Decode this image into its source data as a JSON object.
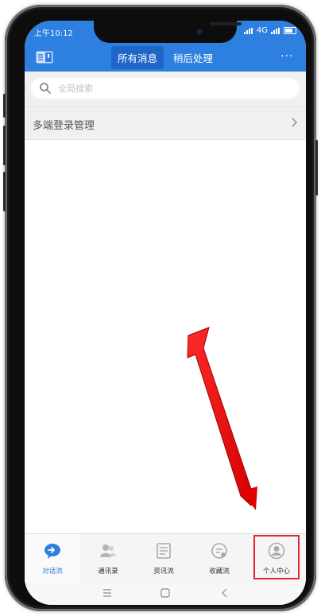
{
  "status_bar": {
    "time": "上午10:12",
    "network": "4G"
  },
  "header": {
    "tabs": [
      {
        "label": "所有消息",
        "active": true
      },
      {
        "label": "稍后处理",
        "active": false
      }
    ],
    "left_icon": "contacts-book-icon",
    "right_icon": "more-icon",
    "accent_color": "#2d7fe0"
  },
  "search": {
    "placeholder": "全局搜索"
  },
  "list": {
    "items": [
      {
        "label": "多端登录管理",
        "icon": "chevron-right-icon"
      }
    ]
  },
  "bottom_nav": {
    "items": [
      {
        "label": "对话流",
        "icon": "chat-icon",
        "active": true
      },
      {
        "label": "通讯录",
        "icon": "contacts-icon",
        "active": false
      },
      {
        "label": "资讯流",
        "icon": "news-icon",
        "active": false
      },
      {
        "label": "收藏流",
        "icon": "favorites-icon",
        "active": false
      },
      {
        "label": "个人中心",
        "icon": "person-icon",
        "active": false,
        "highlighted": true
      }
    ]
  },
  "annotation": {
    "highlight_color": "#e0262a",
    "arrow_target": "个人中心"
  },
  "system_nav": {
    "icons": [
      "menu-icon",
      "home-icon",
      "back-icon"
    ]
  }
}
